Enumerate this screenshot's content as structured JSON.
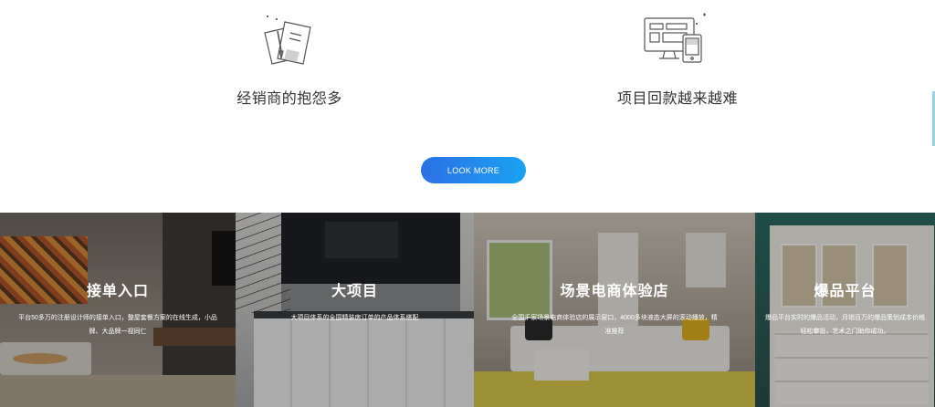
{
  "features": [
    {
      "icon": "document-icon",
      "label": "经销商的抱怨多"
    },
    {
      "icon": "devices-icon",
      "label": "项目回款越来越难"
    }
  ],
  "more_button": {
    "label": "LOOK MORE",
    "colors": [
      "#2c6fe6",
      "#1aa3f2"
    ]
  },
  "panels": [
    {
      "title": "接单入口",
      "desc": "平台50多万的注册设计师的接单入口，整屋套餐方案的在线生成，小品牌、大品牌一视同仁"
    },
    {
      "title": "大项目",
      "desc": "大项目体系的全国精装房订单的产品体系搭配"
    },
    {
      "title": "场景电商体验店",
      "desc": "全国千家场景电商体验店的展示窗口，4000多块液态大屏的滚动播放，精准推荐"
    },
    {
      "title": "爆品平台",
      "desc": "爆品平台实时的爆品活动，月销百万的爆品策划成本价格轻松攀投，艺术之门助你成功。"
    }
  ]
}
